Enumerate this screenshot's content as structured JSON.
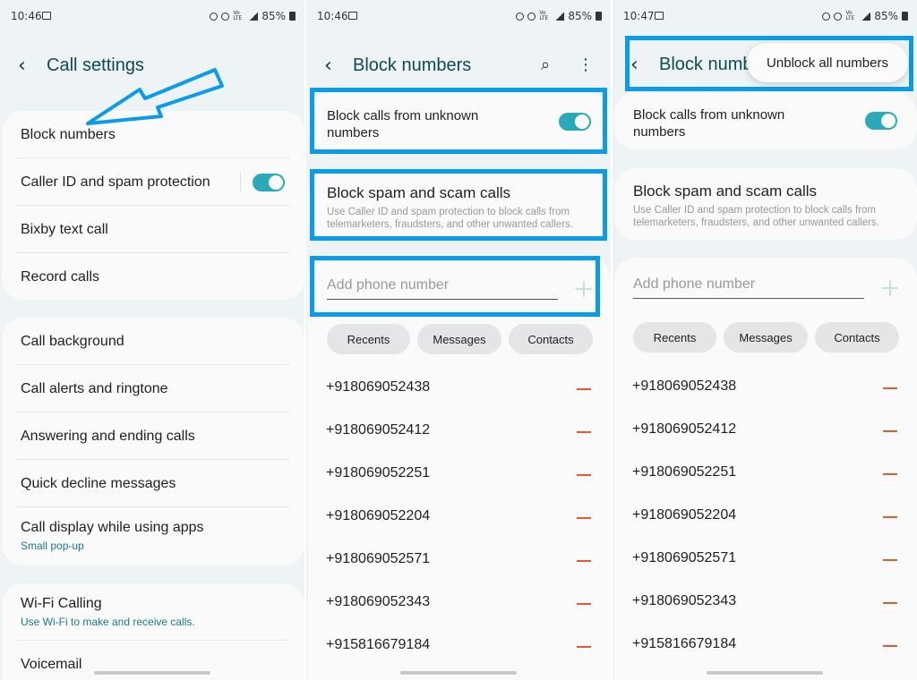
{
  "colors": {
    "accent": "#2aa9b8",
    "highlight": "#0b9bec",
    "remove": "#e65a2e",
    "title": "#0d4a55",
    "subtext": "#1a7a8c"
  },
  "panel1": {
    "time": "10:46",
    "battery": "85%",
    "title": "Call settings",
    "group1": [
      "Block numbers",
      "Caller ID and spam protection",
      "Bixby text call",
      "Record calls"
    ],
    "group2": {
      "call_background": "Call background",
      "alerts": "Call alerts and ringtone",
      "answering": "Answering and ending calls",
      "quick_decline": "Quick decline messages",
      "call_display": "Call display while using apps",
      "call_display_sub": "Small pop-up"
    },
    "group3": {
      "wifi": "Wi-Fi Calling",
      "wifi_sub": "Use Wi-Fi to make and receive calls.",
      "voicemail": "Voicemail"
    }
  },
  "panel2": {
    "time": "10:46",
    "battery": "85%",
    "title": "Block numbers",
    "unknown_line1": "Block calls from unknown",
    "unknown_line2": "numbers",
    "spam_title": "Block spam and scam calls",
    "spam_desc1": "Use Caller ID and spam protection to block calls from",
    "spam_desc2": "telemarketers, fraudsters, and other unwanted callers.",
    "add_placeholder": "Add phone number",
    "chips": [
      "Recents",
      "Messages",
      "Contacts"
    ],
    "numbers": [
      "+918069052438",
      "+918069052412",
      "+918069052251",
      "+918069052204",
      "+918069052571",
      "+918069052343",
      "+915816679184"
    ]
  },
  "panel3": {
    "time": "10:47",
    "battery": "85%",
    "title": "Block numb",
    "menu_item": "Unblock all numbers",
    "unknown_line1": "Block calls from unknown",
    "unknown_line2": "numbers",
    "spam_title": "Block spam and scam calls",
    "spam_desc1": "Use Caller ID and spam protection to block calls from",
    "spam_desc2": "telemarketers, fraudsters, and other unwanted callers.",
    "add_placeholder": "Add phone number",
    "chips": [
      "Recents",
      "Messages",
      "Contacts"
    ],
    "numbers": [
      "+918069052438",
      "+918069052412",
      "+918069052251",
      "+918069052204",
      "+918069052571",
      "+918069052343",
      "+915816679184"
    ]
  }
}
